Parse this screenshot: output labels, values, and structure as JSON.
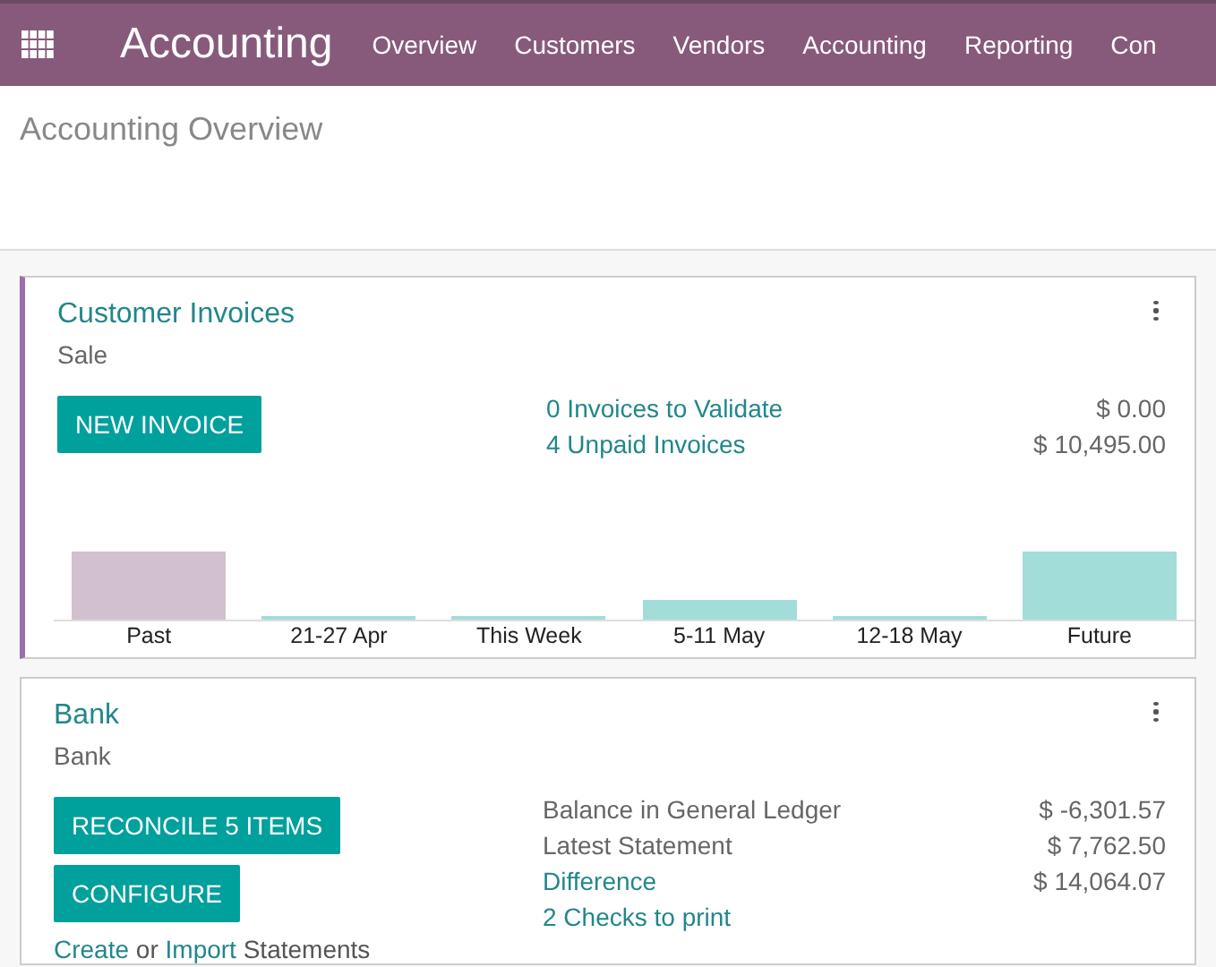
{
  "navbar": {
    "app_title": "Accounting",
    "menu": [
      "Overview",
      "Customers",
      "Vendors",
      "Accounting",
      "Reporting",
      "Con"
    ]
  },
  "breadcrumb": "Accounting Overview",
  "journals": [
    {
      "kind": "sale",
      "title": "Customer Invoices",
      "type": "Sale",
      "buttons": [
        "NEW INVOICE"
      ],
      "stats": [
        {
          "label": "0 Invoices to Validate",
          "value": "$ 0.00",
          "link": true
        },
        {
          "label": "4 Unpaid Invoices",
          "value": "$ 10,495.00",
          "link": true
        }
      ],
      "chart_labels": [
        "Past",
        "21-27 Apr",
        "This Week",
        "5-11 May",
        "12-18 May",
        "Future"
      ]
    },
    {
      "kind": "bank",
      "title": "Bank",
      "type": "Bank",
      "buttons": [
        "RECONCILE 5 ITEMS",
        "CONFIGURE"
      ],
      "footer": [
        {
          "text": "Create",
          "link": true
        },
        {
          "text": "or",
          "link": false
        },
        {
          "text": "Import",
          "link": true
        },
        {
          "text": "Statements",
          "link": false
        }
      ],
      "stats": [
        {
          "label": "Balance in General Ledger",
          "value": "$ -6,301.57",
          "link": false
        },
        {
          "label": "Latest Statement",
          "value": "$ 7,762.50",
          "link": false
        },
        {
          "label": "Difference",
          "value": "$ 14,064.07",
          "link": true
        },
        {
          "label": "2 Checks to print",
          "link": true
        }
      ]
    }
  ]
}
